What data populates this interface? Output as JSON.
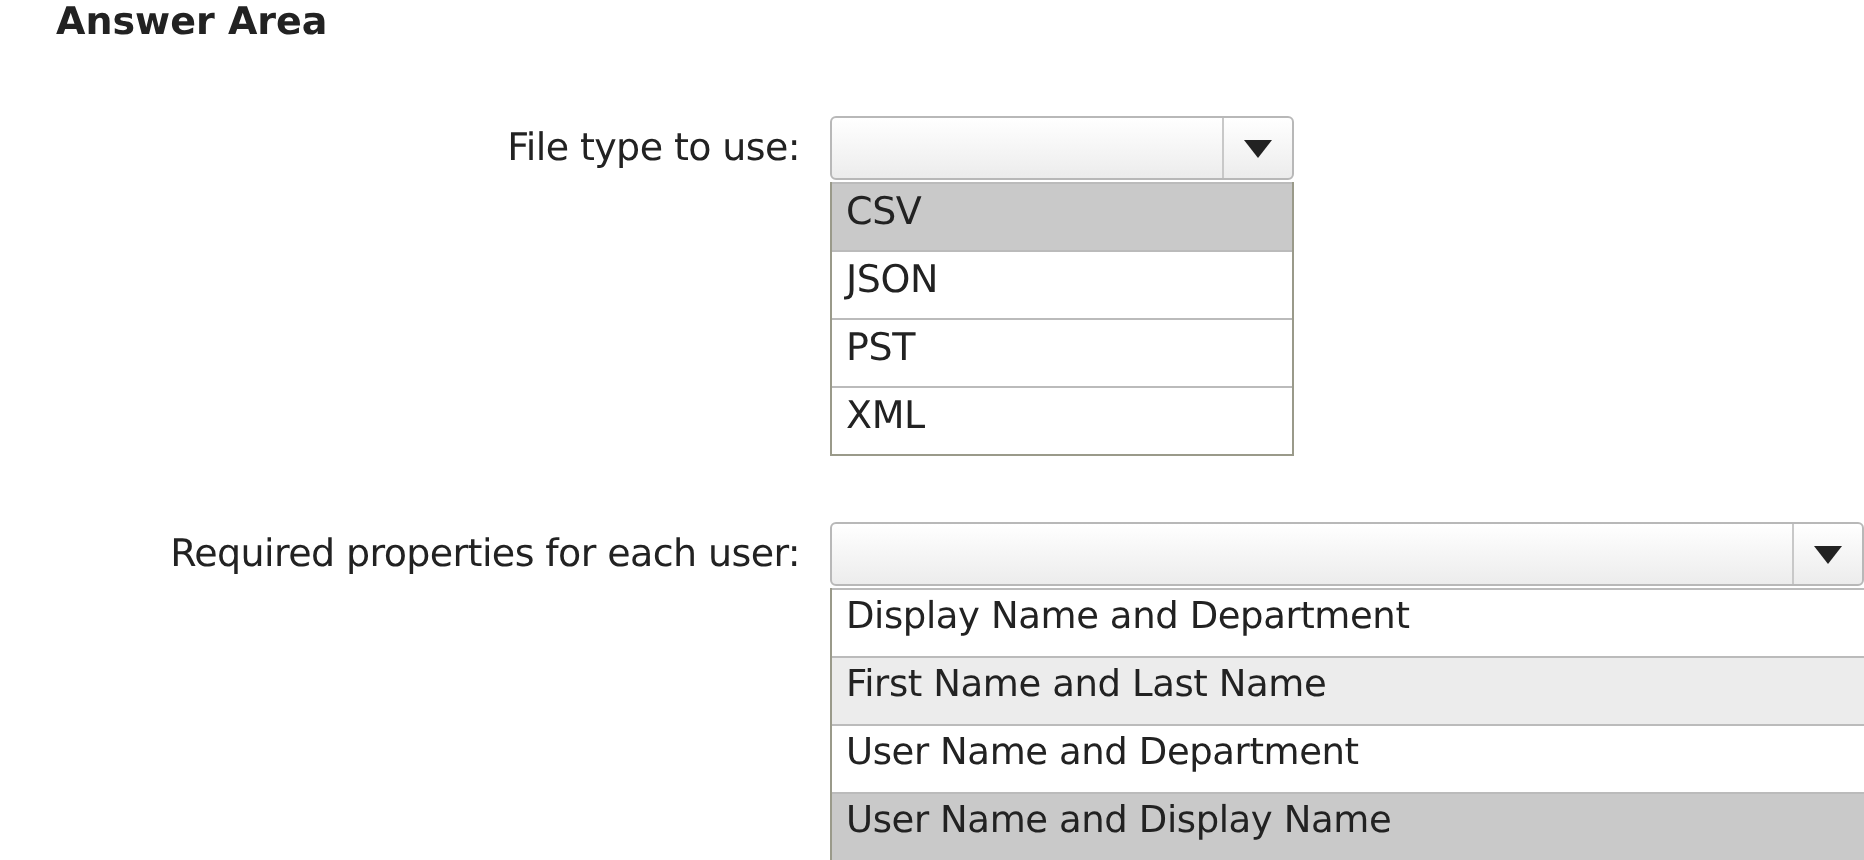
{
  "heading": "Answer Area",
  "dropdowns": [
    {
      "label": "File type to use:",
      "options": [
        {
          "text": "CSV",
          "selected": true,
          "hovered": false
        },
        {
          "text": "JSON",
          "selected": false,
          "hovered": false
        },
        {
          "text": "PST",
          "selected": false,
          "hovered": false
        },
        {
          "text": "XML",
          "selected": false,
          "hovered": false
        }
      ]
    },
    {
      "label": "Required properties for each user:",
      "options": [
        {
          "text": "Display Name and Department",
          "selected": false,
          "hovered": false
        },
        {
          "text": "First Name and Last Name",
          "selected": false,
          "hovered": true
        },
        {
          "text": "User Name and Department",
          "selected": false,
          "hovered": false
        },
        {
          "text": "User Name and Display Name",
          "selected": true,
          "hovered": false
        }
      ]
    }
  ]
}
